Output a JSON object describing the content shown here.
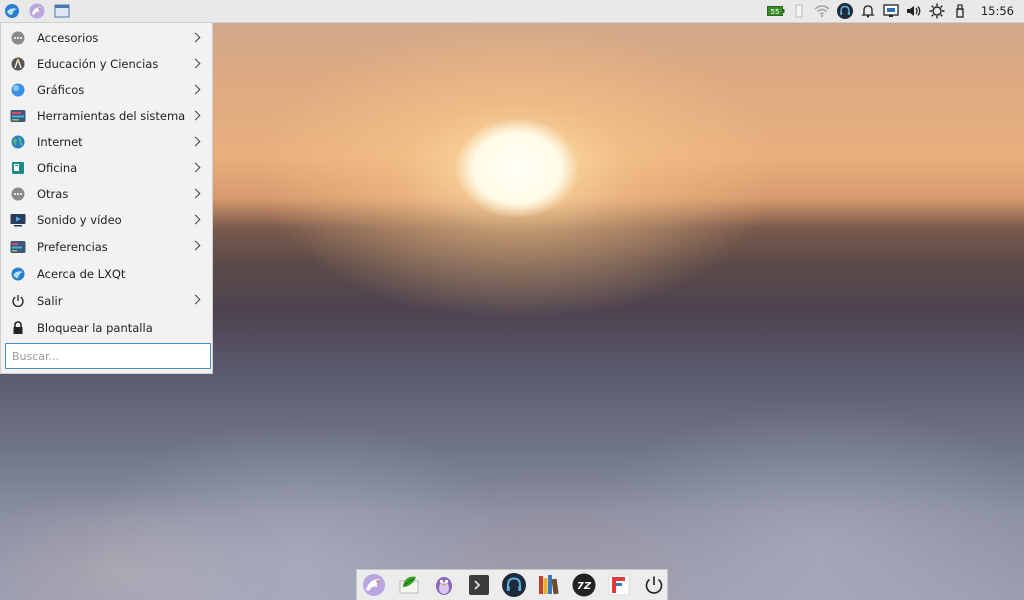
{
  "top_panel": {
    "clock": "15:56",
    "battery_level": "55"
  },
  "menu": {
    "items": [
      {
        "label": "Accesorios",
        "icon": "dots-icon",
        "submenu": true
      },
      {
        "label": "Educación y Ciencias",
        "icon": "compass-icon",
        "submenu": true
      },
      {
        "label": "Gráficos",
        "icon": "graphics-icon",
        "submenu": true
      },
      {
        "label": "Herramientas del sistema",
        "icon": "system-tools-icon",
        "submenu": true
      },
      {
        "label": "Internet",
        "icon": "globe-icon",
        "submenu": true
      },
      {
        "label": "Oficina",
        "icon": "office-icon",
        "submenu": true
      },
      {
        "label": "Otras",
        "icon": "dots-icon",
        "submenu": true
      },
      {
        "label": "Sonido y vídeo",
        "icon": "multimedia-icon",
        "submenu": true
      },
      {
        "label": "Preferencias",
        "icon": "preferences-icon",
        "submenu": true
      },
      {
        "label": "Acerca de LXQt",
        "icon": "lxqt-icon",
        "submenu": false
      },
      {
        "label": "Salir",
        "icon": "power-icon",
        "submenu": true
      },
      {
        "label": "Bloquear la pantalla",
        "icon": "lock-icon",
        "submenu": false
      }
    ],
    "search_placeholder": "Buscar..."
  },
  "colors": {
    "panel_bg": "#e9e9e9",
    "menu_bg": "#f2f2f2",
    "search_border": "#4a90c8",
    "battery_green": "#3a8a2a"
  }
}
